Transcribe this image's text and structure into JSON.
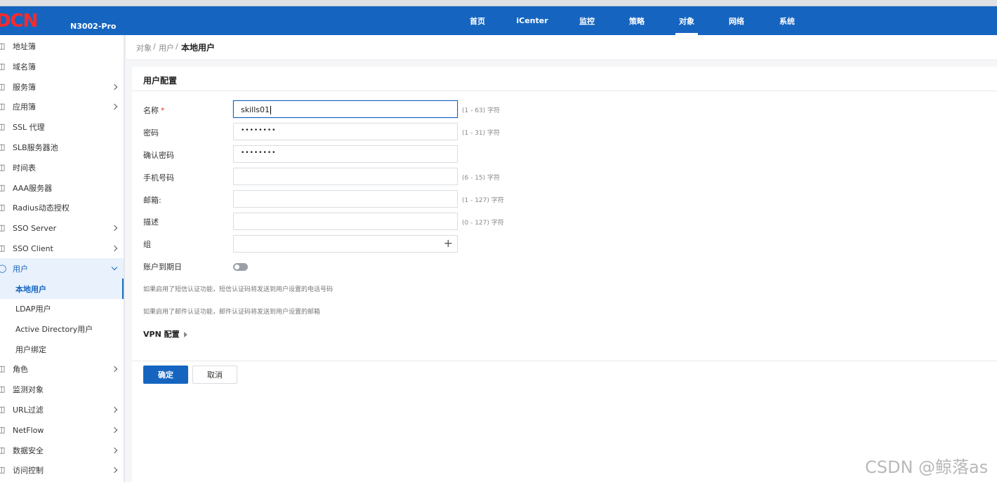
{
  "brand": {
    "logo": "DCN",
    "model": "N3002-Pro",
    "logo_color": "#ff2a2a"
  },
  "colors": {
    "primary": "#1565c0",
    "topbar": "#1565c0"
  },
  "nav": {
    "items": [
      {
        "label": "首页"
      },
      {
        "label": "iCenter"
      },
      {
        "label": "监控"
      },
      {
        "label": "策略"
      },
      {
        "label": "对象",
        "active": true
      },
      {
        "label": "网络"
      },
      {
        "label": "系统"
      }
    ]
  },
  "sidebar": {
    "items": [
      {
        "label": "地址簿",
        "icon": "address-book-icon"
      },
      {
        "label": "域名簿",
        "icon": "domain-book-icon"
      },
      {
        "label": "服务簿",
        "icon": "service-book-icon",
        "expandable": true
      },
      {
        "label": "应用簿",
        "icon": "app-book-icon",
        "expandable": true
      },
      {
        "label": "SSL 代理",
        "icon": "ssl-proxy-icon"
      },
      {
        "label": "SLB服务器池",
        "icon": "slb-pool-icon"
      },
      {
        "label": "时间表",
        "icon": "schedule-icon"
      },
      {
        "label": "AAA服务器",
        "icon": "aaa-server-icon"
      },
      {
        "label": "Radius动态授权",
        "icon": "radius-icon"
      },
      {
        "label": "SSO Server",
        "icon": "sso-server-icon",
        "expandable": true
      },
      {
        "label": "SSO Client",
        "icon": "sso-client-icon",
        "expandable": true
      },
      {
        "label": "用户",
        "icon": "user-icon",
        "expandable": true,
        "open": true
      },
      {
        "label": "本地用户",
        "sub": true,
        "active": true
      },
      {
        "label": "LDAP用户",
        "sub": true
      },
      {
        "label": "Active Directory用户",
        "sub": true
      },
      {
        "label": "用户绑定",
        "sub": true
      },
      {
        "label": "角色",
        "icon": "role-icon",
        "expandable": true
      },
      {
        "label": "监测对象",
        "icon": "monitor-object-icon"
      },
      {
        "label": "URL过滤",
        "icon": "url-filter-icon",
        "expandable": true
      },
      {
        "label": "NetFlow",
        "icon": "netflow-icon",
        "expandable": true
      },
      {
        "label": "数据安全",
        "icon": "data-security-icon",
        "expandable": true
      },
      {
        "label": "访问控制",
        "icon": "access-control-icon",
        "expandable": true
      }
    ]
  },
  "breadcrumb": {
    "part1": "对象",
    "sep": "/",
    "part2": "用户",
    "current": "本地用户"
  },
  "form": {
    "title": "用户配置",
    "name": {
      "label": "名称",
      "required": "*",
      "value": "skills01",
      "hint": "(1 - 63) 字符"
    },
    "password": {
      "label": "密码",
      "value": "••••••••",
      "hint": "(1 - 31) 字符"
    },
    "confirm": {
      "label": "确认密码",
      "value": "••••••••"
    },
    "phone": {
      "label": "手机号码",
      "value": "",
      "hint": "(6 - 15) 字符"
    },
    "email": {
      "label": "邮箱:",
      "value": "",
      "hint": "(1 - 127) 字符"
    },
    "desc": {
      "label": "描述",
      "value": "",
      "hint": "(0 - 127) 字符"
    },
    "group": {
      "label": "组",
      "value": ""
    },
    "expiry": {
      "label": "账户到期日",
      "enabled": false
    },
    "note_sms": "如果启用了短信认证功能，短信认证码将发送到用户设置的电话号码",
    "note_mail": "如果启用了邮件认证功能，邮件认证码将发送到用户设置的邮箱",
    "vpn": "VPN 配置",
    "ok": "确定",
    "cancel": "取消"
  },
  "watermark": "CSDN @鲸落as"
}
